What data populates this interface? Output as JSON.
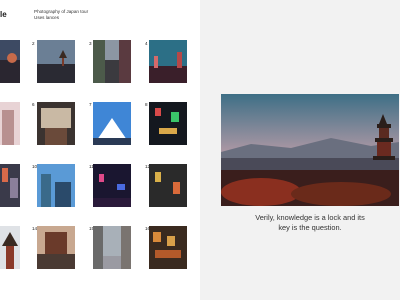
{
  "header": {
    "logo_text": "le",
    "caption_line1": "Photography of Japan tour",
    "caption_line2": "Uses lances"
  },
  "gallery": {
    "numbers": [
      "2",
      "3",
      "4",
      "6",
      "7",
      "8",
      "10",
      "11",
      "12",
      "14",
      "15",
      "16"
    ]
  },
  "preview": {
    "quote_line1": "Verily, knowledge is a lock and its",
    "quote_line2": "key is the question."
  },
  "colors": {
    "left_bg": "#ffffff",
    "right_bg": "#f2f2f2"
  }
}
